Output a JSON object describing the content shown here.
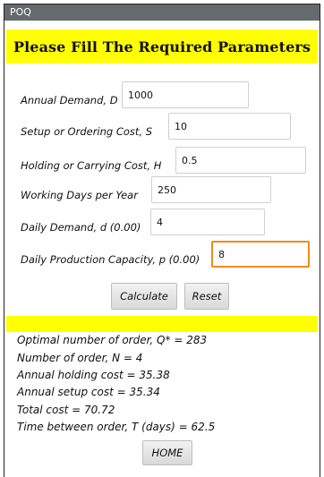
{
  "window": {
    "title": "POQ"
  },
  "banner": {
    "text": "Please Fill The Required Parameters"
  },
  "fields": [
    {
      "label": "Annual Demand, D",
      "value": "1000"
    },
    {
      "label": "Setup or Ordering Cost, S",
      "value": "10"
    },
    {
      "label": "Holding or Carrying Cost, H",
      "value": "0.5"
    },
    {
      "label": "Working Days per Year",
      "value": "250"
    },
    {
      "label": "Daily Demand, d (0.00)",
      "value": "4"
    },
    {
      "label": "Daily Production Capacity, p (0.00)",
      "value": "8"
    }
  ],
  "buttons": {
    "calculate": "Calculate",
    "reset": "Reset",
    "home": "HOME"
  },
  "results": [
    "Optimal number of order, Q* = 283",
    "Number of order, N = 4",
    "Annual holding cost = 35.38",
    "Annual setup cost = 35.34",
    "Total cost = 70.72",
    "Time between order, T (days) = 62.5"
  ],
  "colors": {
    "banner": "#ffff00",
    "titlebar": "#666a6c",
    "focus": "#f08a1c"
  }
}
